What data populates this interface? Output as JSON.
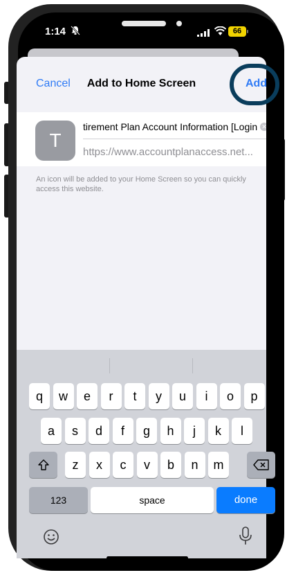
{
  "status_bar": {
    "time": "1:14",
    "battery_level": "66",
    "battery_color": "#f2d400"
  },
  "sheet": {
    "cancel_label": "Cancel",
    "title": "Add to Home Screen",
    "add_label": "Add"
  },
  "form": {
    "icon_letter": "T",
    "name_value": "tirement Plan Account Information [Login]",
    "url_value": "https://www.accountplanaccess.net..."
  },
  "helper_text": "An icon will be added to your Home Screen so you can quickly access this website.",
  "keyboard": {
    "row1": [
      "q",
      "w",
      "e",
      "r",
      "t",
      "y",
      "u",
      "i",
      "o",
      "p"
    ],
    "row2": [
      "a",
      "s",
      "d",
      "f",
      "g",
      "h",
      "j",
      "k",
      "l"
    ],
    "row3": [
      "z",
      "x",
      "c",
      "v",
      "b",
      "n",
      "m"
    ],
    "numbers_label": "123",
    "space_label": "space",
    "done_label": "done"
  },
  "colors": {
    "accent": "#2f7bf6",
    "done_key": "#0a7cff",
    "highlight_ring": "#0a3d5c"
  }
}
